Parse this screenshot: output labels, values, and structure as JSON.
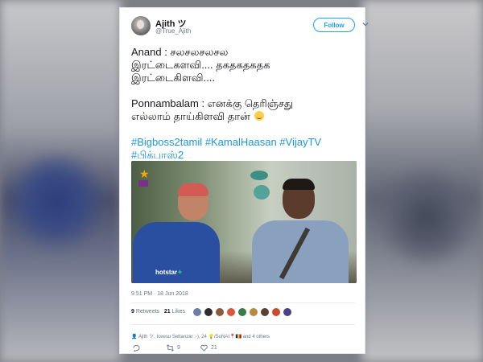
{
  "tweet": {
    "author": {
      "name": "Ajith ツ",
      "handle": "@True_Ajith",
      "follow_label": "Follow",
      "avatar_icon": "user-avatar"
    },
    "text_lines": [
      "Anand : சலசலசலசல",
      "இரட்டைகளவி....  தகதகதகதக",
      "இரட்டைகிளவி....",
      "Ponnambalam : எனக்கு தெரிஞ்சது",
      "எல்லாம் தாய்கிளவி தான்"
    ],
    "emoji": "grinning-face-emoji",
    "hashtags_line1": [
      "#Bigboss2tamil",
      "#KamalHaasan",
      "#VijayTV"
    ],
    "hashtags_line2": [
      "#பிக்பாஸ்2"
    ],
    "media": {
      "watermark": "hotstar"
    },
    "timestamp": "9:51 PM · 18 Jun 2018",
    "retweets_count": "9",
    "retweets_label": "Retweets",
    "likes_count": "21",
    "likes_label": "Likes",
    "reply_context": "Ajith ツ, Iceesu Settanzar :-), 24 💡/SuNAI📍🇷🇴 and 4 others",
    "actions": {
      "reply_count": "",
      "retweet_count": "9",
      "like_count": "21"
    },
    "colors": {
      "accent": "#1da1f2",
      "hashtag": "#1b95e0",
      "text": "#14171a",
      "muted": "#657786"
    }
  }
}
